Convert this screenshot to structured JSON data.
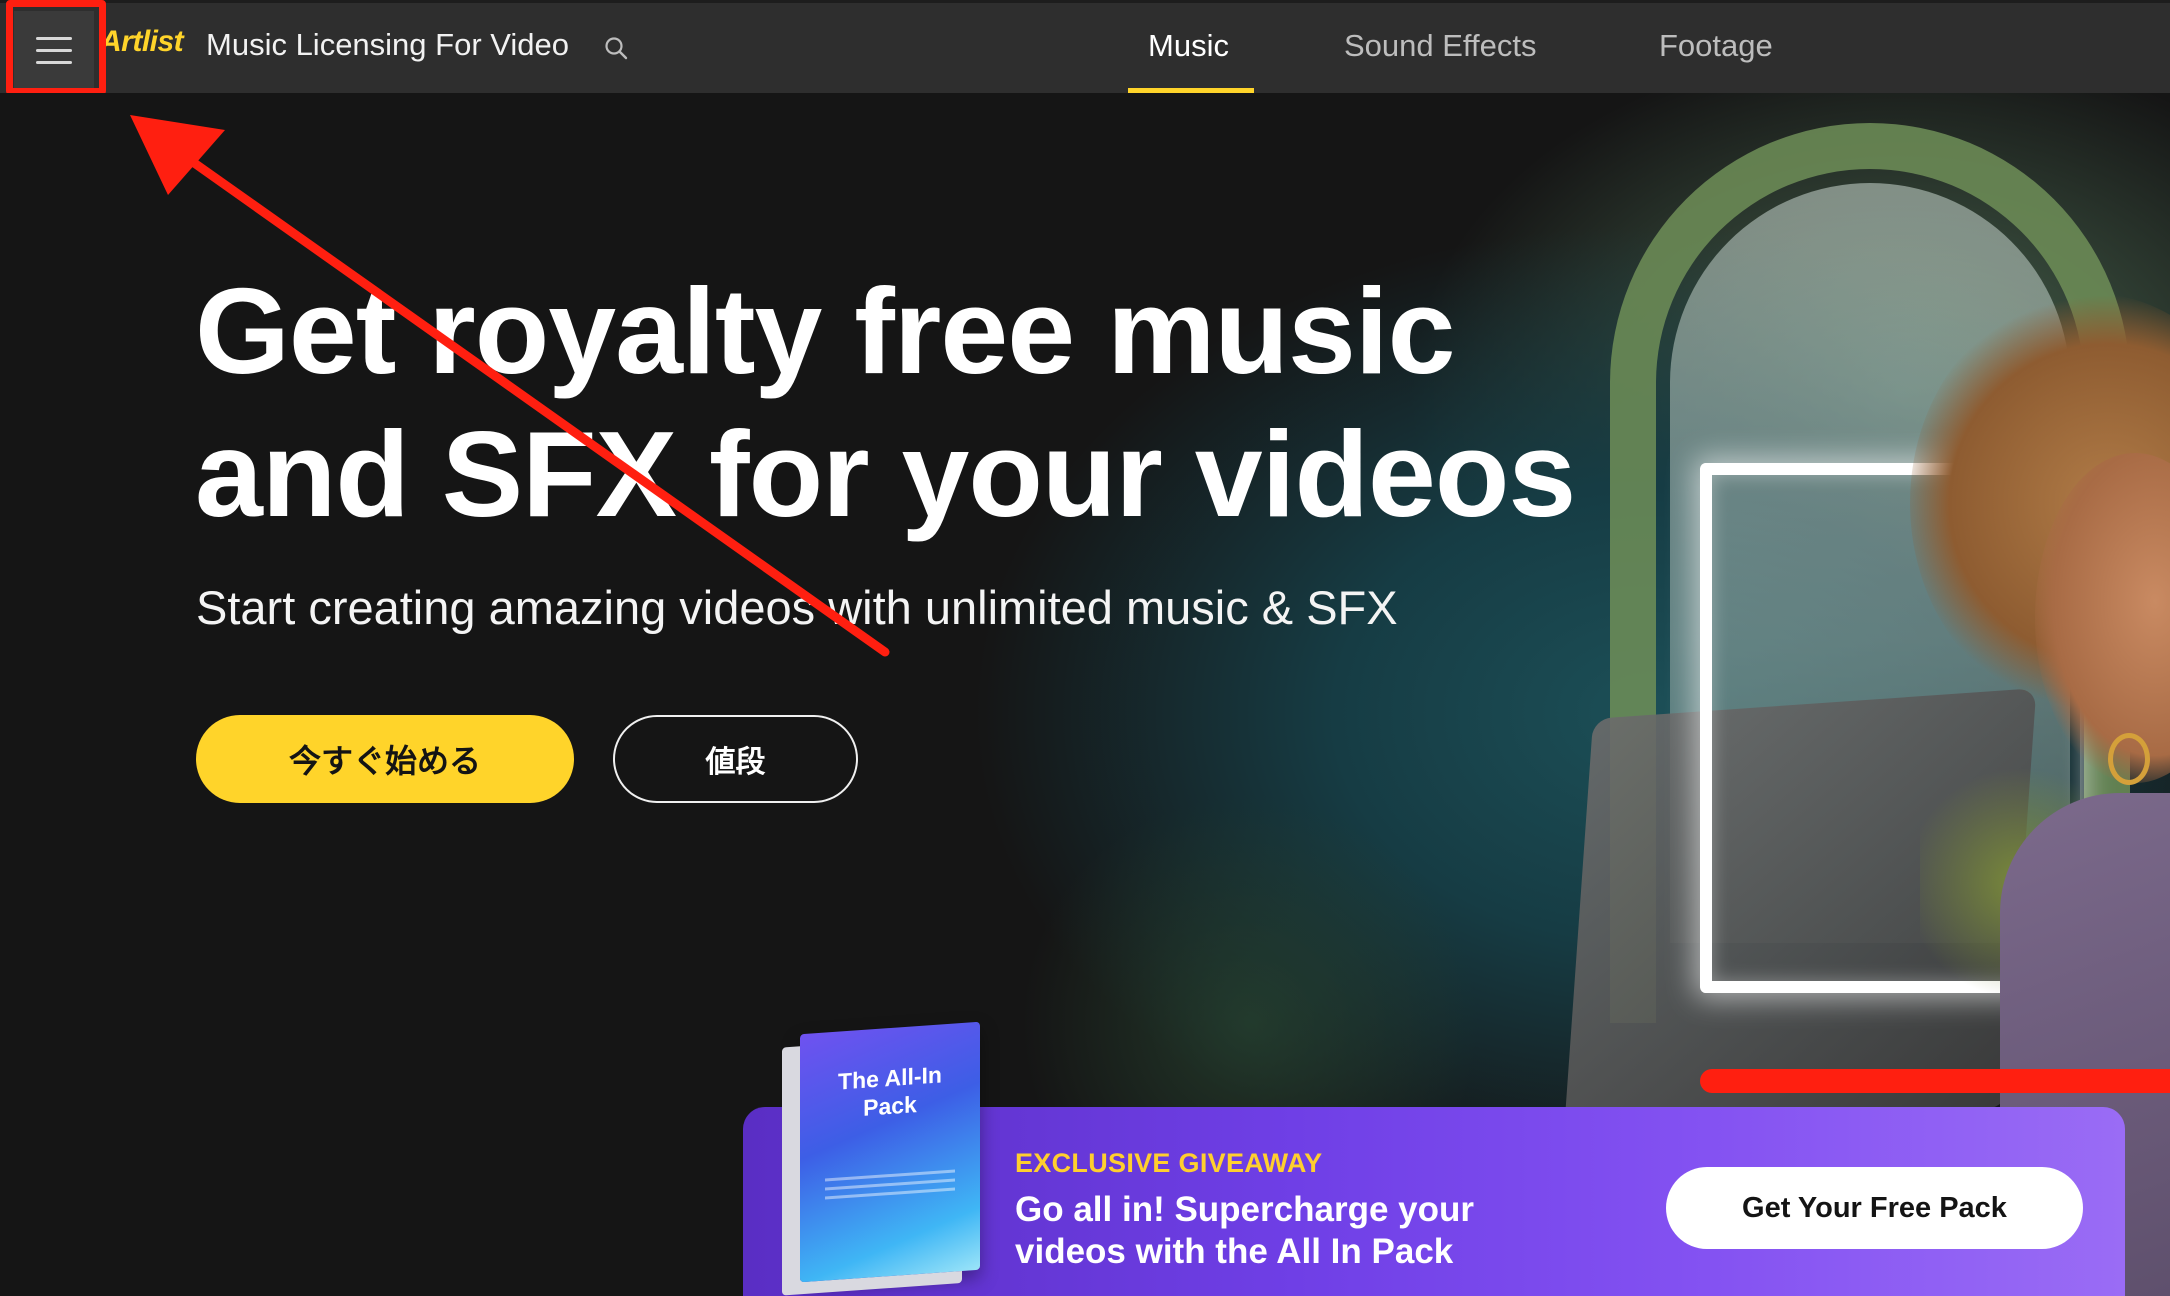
{
  "header": {
    "logo_text": "Artlist",
    "site_title": "Music Licensing For Video",
    "tabs": [
      {
        "label": "Music",
        "active": true
      },
      {
        "label": "Sound Effects",
        "active": false
      },
      {
        "label": "Footage",
        "active": false
      }
    ],
    "icons": [
      "hamburger-menu-icon",
      "search-icon"
    ],
    "accent_color": "#ffd42a"
  },
  "hero": {
    "title_line1": "Get royalty free music",
    "title_line2": "and SFX for your videos",
    "subtitle": "Start creating amazing videos with unlimited music & SFX",
    "primary_button": "今すぐ始める",
    "secondary_button": "値段"
  },
  "promo": {
    "pack_title_line1": "The All-In",
    "pack_title_line2": "Pack",
    "eyebrow": "EXCLUSIVE GIVEAWAY",
    "text_line1": "Go all in! Supercharge your",
    "text_line2": "videos with the All In Pack",
    "cta": "Get Your Free Pack"
  },
  "annotation": {
    "highlight_color": "#ff1f10"
  }
}
